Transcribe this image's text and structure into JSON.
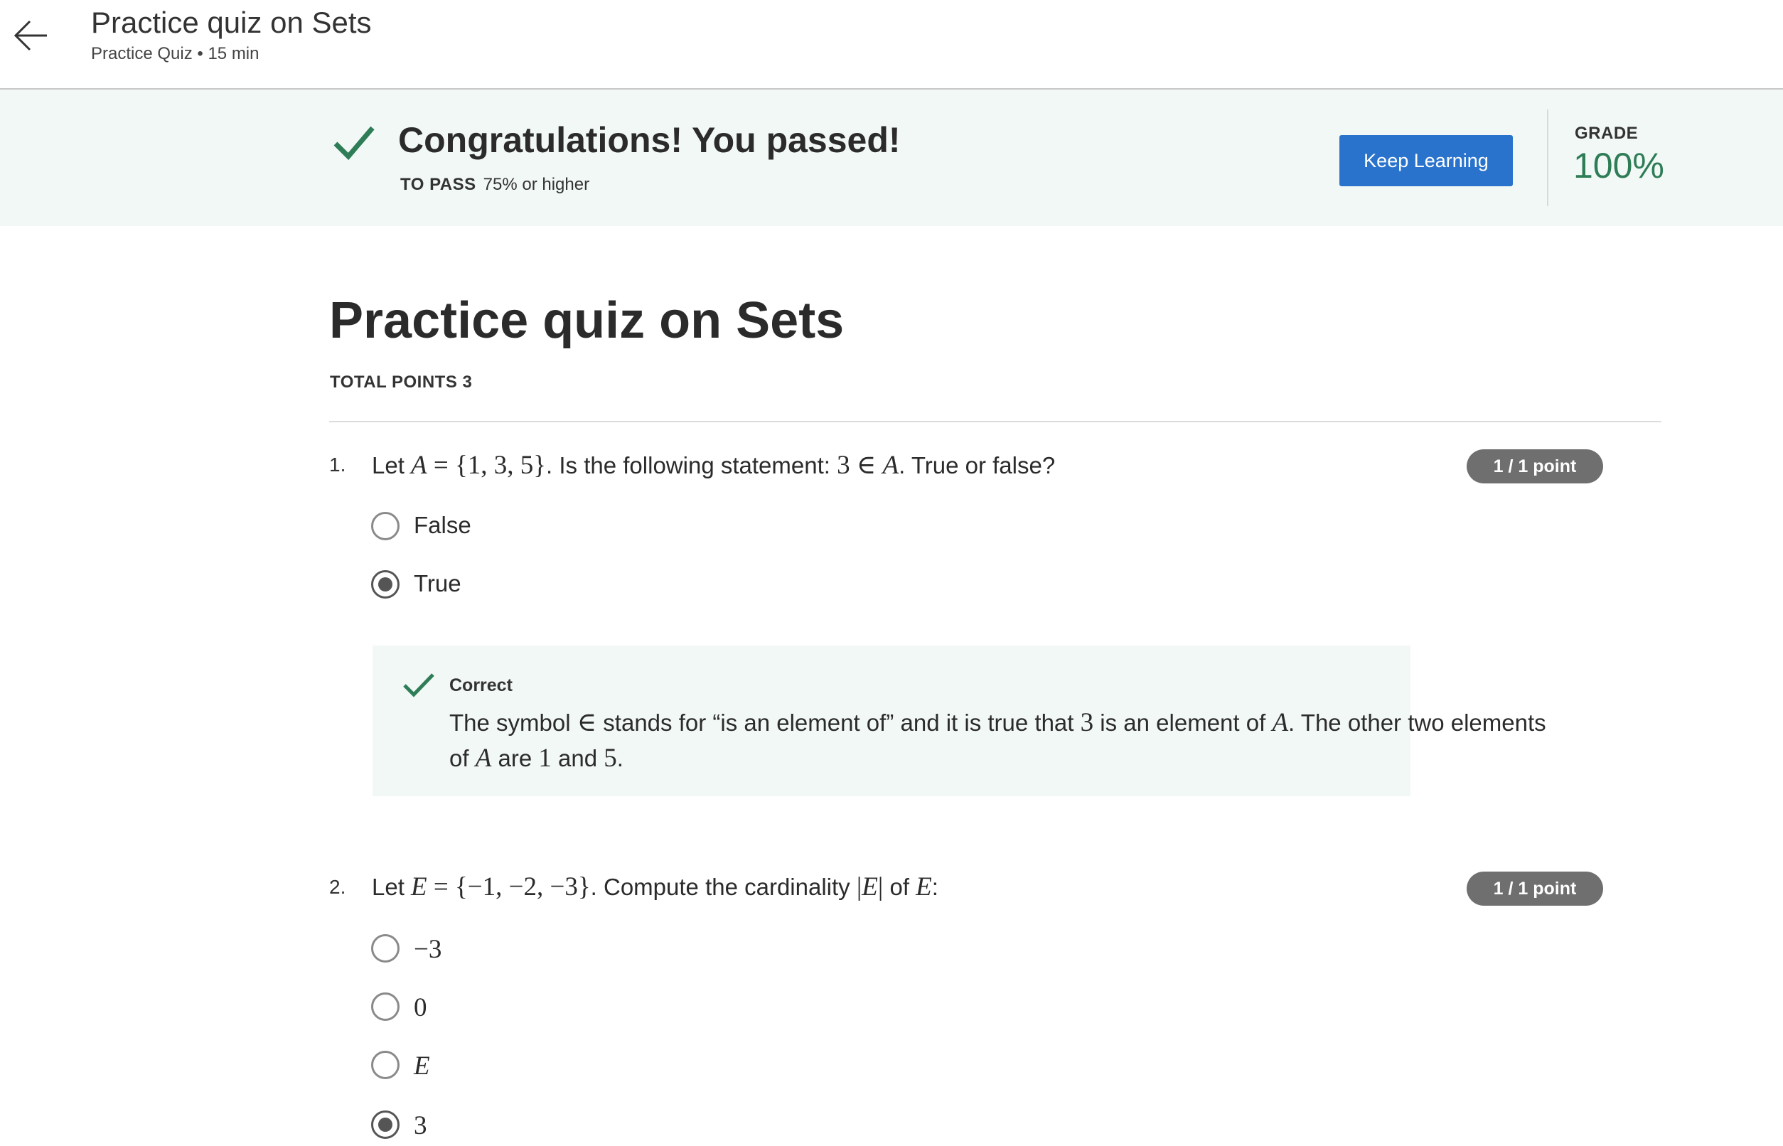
{
  "header": {
    "title": "Practice quiz on Sets",
    "subtitle": "Practice Quiz • 15 min"
  },
  "banner": {
    "title": "Congratulations! You passed!",
    "to_pass_label": "TO PASS",
    "to_pass_value": "75% or higher",
    "button_label": "Keep Learning",
    "grade_label": "GRADE",
    "grade_value": "100%",
    "accent_color": "#2e7d57",
    "button_color": "#2a73cc"
  },
  "quiz": {
    "title": "Practice quiz on Sets",
    "total_points": "TOTAL POINTS 3"
  },
  "questions": [
    {
      "number": "1.",
      "points": "1 / 1 point",
      "text_parts": [
        "Let ",
        "A",
        " = {1, 3, 5}",
        ". Is the following statement: ",
        "3 ∈ ",
        "A",
        ". True or false?"
      ],
      "options": [
        {
          "label": "False",
          "selected": false
        },
        {
          "label": "True",
          "selected": true
        }
      ],
      "feedback": {
        "title": "Correct",
        "text_parts": [
          "The symbol ",
          "∈",
          " stands for “is an element of” and it is true that ",
          "3",
          " is an element of ",
          "A",
          ". The other two elements of ",
          "A",
          " are ",
          "1",
          " and ",
          "5",
          "."
        ]
      }
    },
    {
      "number": "2.",
      "points": "1 / 1 point",
      "text_parts": [
        "Let ",
        "E",
        " = {−1, −2, −3}",
        ". Compute the cardinality ",
        "|",
        "E",
        "|",
        " of ",
        "E",
        ":"
      ],
      "options": [
        {
          "label": "−3",
          "selected": false
        },
        {
          "label": "0",
          "selected": false
        },
        {
          "label": "E",
          "selected": false
        },
        {
          "label": "3",
          "selected": true
        }
      ]
    }
  ],
  "icons": [
    "back-arrow-icon",
    "check-icon"
  ]
}
